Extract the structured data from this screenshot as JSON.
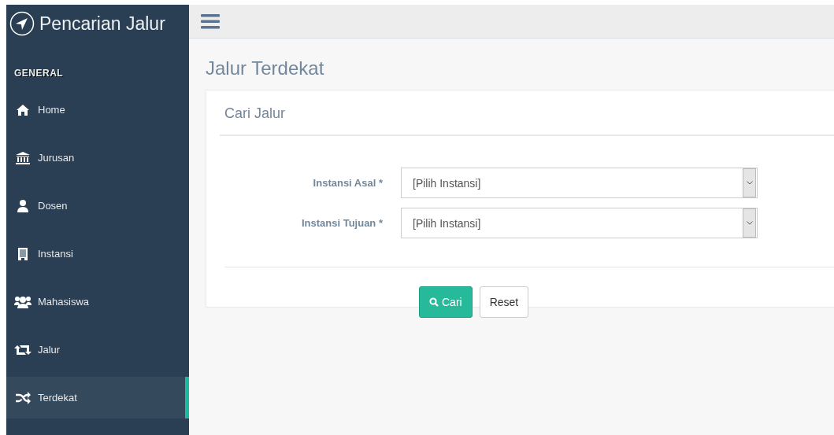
{
  "sidebar": {
    "brand": "Pencarian Jalur",
    "section": "GENERAL",
    "items": [
      {
        "label": "Home",
        "kind": "home",
        "selected": false
      },
      {
        "label": "Jurusan",
        "kind": "bank",
        "selected": false
      },
      {
        "label": "Dosen",
        "kind": "user",
        "selected": false
      },
      {
        "label": "Instansi",
        "kind": "building",
        "selected": false
      },
      {
        "label": "Mahasiswa",
        "kind": "users",
        "selected": false
      },
      {
        "label": "Jalur",
        "kind": "retweet",
        "selected": false
      },
      {
        "label": "Terdekat",
        "kind": "shuffle",
        "selected": true
      }
    ]
  },
  "page_title": "Jalur Terdekat",
  "panel": {
    "title": "Cari Jalur",
    "fields": [
      {
        "label": "Instansi Asal *",
        "value": "[Pilih Instansi]"
      },
      {
        "label": "Instansi Tujuan *",
        "value": "[Pilih Instansi]"
      }
    ],
    "buttons": [
      {
        "label": "Cari",
        "kind": "primary"
      },
      {
        "label": "Reset",
        "kind": "default"
      }
    ]
  }
}
